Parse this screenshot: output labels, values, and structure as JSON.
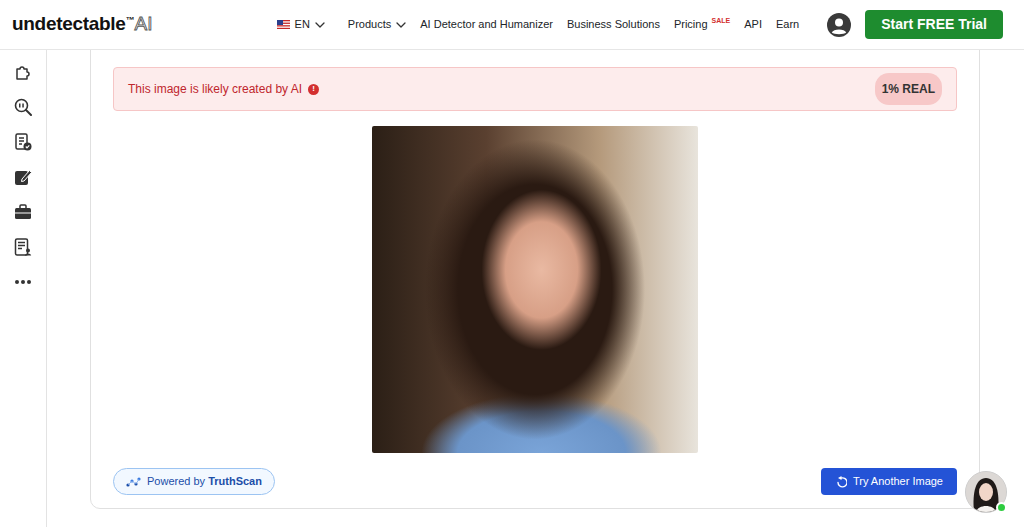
{
  "logo": {
    "name": "undetectable",
    "trademark": "™",
    "suffix": "AI"
  },
  "language": {
    "label": "EN"
  },
  "nav": [
    {
      "label": "Products",
      "has_menu": true
    },
    {
      "label": "AI Detector and Humanizer",
      "has_menu": false
    },
    {
      "label": "Business Solutions",
      "has_menu": false
    },
    {
      "label": "Pricing",
      "has_menu": false,
      "badge": "SALE"
    },
    {
      "label": "API",
      "has_menu": false
    },
    {
      "label": "Earn",
      "has_menu": false
    }
  ],
  "cta": "Start FREE Trial",
  "result": {
    "message": "This image is likely created by AI",
    "alert_icon": "!",
    "score": "1% REAL"
  },
  "powered_by": {
    "prefix": "Powered by",
    "brand": "TruthScan"
  },
  "retry_button": "Try Another Image",
  "chat": {
    "online": true
  }
}
